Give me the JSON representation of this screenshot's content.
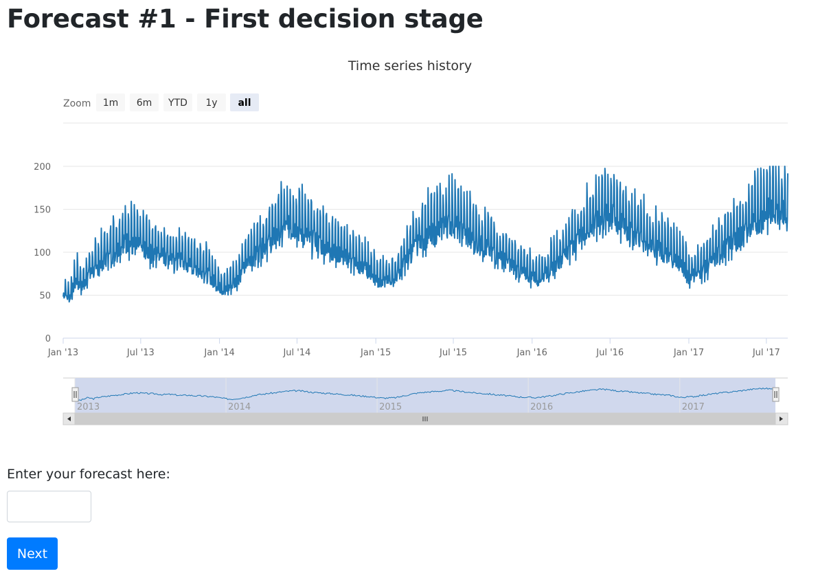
{
  "page": {
    "title": "Forecast #1 - First decision stage"
  },
  "zoom": {
    "label": "Zoom",
    "buttons": [
      {
        "label": "1m",
        "active": false
      },
      {
        "label": "6m",
        "active": false
      },
      {
        "label": "YTD",
        "active": false
      },
      {
        "label": "1y",
        "active": false
      },
      {
        "label": "all",
        "active": true
      }
    ]
  },
  "navigator": {
    "year_labels": [
      "2013",
      "2014",
      "2015",
      "2016",
      "2017"
    ],
    "scrollbar_grip_icon": "grip-lines-icon",
    "left_arrow_icon": "arrow-left-icon",
    "right_arrow_icon": "arrow-right-icon"
  },
  "form": {
    "label": "Enter your forecast here:",
    "input_value": "",
    "input_placeholder": "",
    "next_label": "Next"
  },
  "colors": {
    "series": "#1f77b4",
    "navigator_mask": "#cdd6ec",
    "button_primary": "#007bff"
  },
  "chart_data": {
    "type": "line",
    "title": "Time series history",
    "xlabel": "",
    "ylabel": "",
    "ylim": [
      0,
      200
    ],
    "yticks": [
      0,
      50,
      100,
      150,
      200
    ],
    "xlim": [
      "2013-01-01",
      "2017-08-20"
    ],
    "xticks": [
      {
        "label": "Jan '13",
        "date": "2013-01-01"
      },
      {
        "label": "Jul '13",
        "date": "2013-07-01"
      },
      {
        "label": "Jan '14",
        "date": "2014-01-01"
      },
      {
        "label": "Jul '14",
        "date": "2014-07-01"
      },
      {
        "label": "Jan '15",
        "date": "2015-01-01"
      },
      {
        "label": "Jul '15",
        "date": "2015-07-01"
      },
      {
        "label": "Jan '16",
        "date": "2016-01-01"
      },
      {
        "label": "Jul '16",
        "date": "2016-07-01"
      },
      {
        "label": "Jan '17",
        "date": "2017-01-01"
      },
      {
        "label": "Jul '17",
        "date": "2017-07-01"
      }
    ],
    "grid": true,
    "legend": "none",
    "series": [
      {
        "x": [
          "2013-01-01",
          "2013-01-15",
          "2013-02-01",
          "2013-02-15",
          "2013-03-01",
          "2013-03-15",
          "2013-04-01",
          "2013-04-15",
          "2013-05-01",
          "2013-05-15",
          "2013-06-01",
          "2013-06-15",
          "2013-07-01",
          "2013-07-15",
          "2013-08-01",
          "2013-08-15",
          "2013-09-01",
          "2013-09-15",
          "2013-10-01",
          "2013-10-15",
          "2013-11-01",
          "2013-11-15",
          "2013-12-01",
          "2013-12-15",
          "2014-01-01",
          "2014-01-15",
          "2014-02-01",
          "2014-02-15",
          "2014-03-01",
          "2014-03-15",
          "2014-04-01",
          "2014-04-15",
          "2014-05-01",
          "2014-05-15",
          "2014-06-01",
          "2014-06-15",
          "2014-07-01",
          "2014-07-15",
          "2014-08-01",
          "2014-08-15",
          "2014-09-01",
          "2014-09-15",
          "2014-10-01",
          "2014-10-15",
          "2014-11-01",
          "2014-11-15",
          "2014-12-01",
          "2014-12-15",
          "2015-01-01",
          "2015-01-15",
          "2015-02-01",
          "2015-02-15",
          "2015-03-01",
          "2015-03-15",
          "2015-04-01",
          "2015-04-15",
          "2015-05-01",
          "2015-05-15",
          "2015-06-01",
          "2015-06-15",
          "2015-07-01",
          "2015-07-15",
          "2015-08-01",
          "2015-08-15",
          "2015-09-01",
          "2015-09-15",
          "2015-10-01",
          "2015-10-15",
          "2015-11-01",
          "2015-11-15",
          "2015-12-01",
          "2015-12-15",
          "2016-01-01",
          "2016-01-15",
          "2016-02-01",
          "2016-02-15",
          "2016-03-01",
          "2016-03-15",
          "2016-04-01",
          "2016-04-15",
          "2016-05-01",
          "2016-05-15",
          "2016-06-01",
          "2016-06-15",
          "2016-07-01",
          "2016-07-15",
          "2016-08-01",
          "2016-08-15",
          "2016-09-01",
          "2016-09-15",
          "2016-10-01",
          "2016-10-15",
          "2016-11-01",
          "2016-11-15",
          "2016-12-01",
          "2016-12-15",
          "2017-01-01",
          "2017-01-15",
          "2017-02-01",
          "2017-02-15",
          "2017-03-01",
          "2017-03-15",
          "2017-04-01",
          "2017-04-15",
          "2017-05-01",
          "2017-05-15",
          "2017-06-01",
          "2017-06-15",
          "2017-07-01",
          "2017-07-15",
          "2017-08-01",
          "2017-08-15",
          "2017-08-20"
        ],
        "values": [
          55,
          48,
          72,
          62,
          78,
          82,
          92,
          98,
          105,
          112,
          118,
          112,
          110,
          108,
          100,
          104,
          98,
          92,
          96,
          90,
          88,
          84,
          80,
          72,
          62,
          58,
          66,
          74,
          86,
          98,
          104,
          112,
          118,
          126,
          132,
          136,
          134,
          128,
          120,
          118,
          112,
          110,
          104,
          100,
          96,
          90,
          86,
          82,
          74,
          68,
          70,
          72,
          84,
          96,
          110,
          118,
          124,
          128,
          132,
          138,
          140,
          132,
          126,
          120,
          114,
          110,
          106,
          98,
          94,
          88,
          82,
          78,
          75,
          72,
          78,
          84,
          92,
          102,
          112,
          118,
          126,
          134,
          140,
          146,
          150,
          144,
          136,
          130,
          126,
          120,
          114,
          110,
          104,
          100,
          96,
          90,
          74,
          78,
          82,
          88,
          96,
          104,
          112,
          118,
          124,
          130,
          138,
          146,
          152,
          158,
          156,
          150,
          140
        ]
      }
    ],
    "annotations": []
  }
}
